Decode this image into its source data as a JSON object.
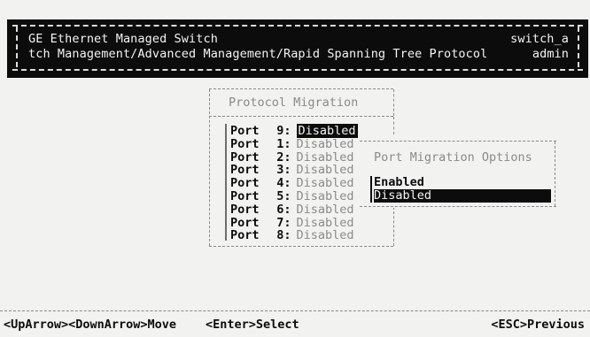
{
  "header": {
    "title": "GE Ethernet Managed Switch",
    "path": "tch Management/Advanced Management/Rapid Spanning Tree Protocol",
    "hostname": "switch_a",
    "user": "admin"
  },
  "menu": {
    "title": "Protocol Migration",
    "port_prefix": "Port",
    "rows": [
      {
        "num": "9:",
        "value": "Disabled",
        "selected": true
      },
      {
        "num": "1:",
        "value": "Disabled",
        "selected": false
      },
      {
        "num": "2:",
        "value": "Disabled",
        "selected": false
      },
      {
        "num": "3:",
        "value": "Disabled",
        "selected": false
      },
      {
        "num": "4:",
        "value": "Disabled",
        "selected": false
      },
      {
        "num": "5:",
        "value": "Disabled",
        "selected": false
      },
      {
        "num": "6:",
        "value": "Disabled",
        "selected": false
      },
      {
        "num": "7:",
        "value": "Disabled",
        "selected": false
      },
      {
        "num": "8:",
        "value": "Disabled",
        "selected": false
      }
    ]
  },
  "popup": {
    "title": "Port Migration Options",
    "options": [
      "Enabled",
      "Disabled"
    ],
    "selected": "Disabled"
  },
  "footer": {
    "move_hint": "<UpArrow><DownArrow>Move",
    "select_hint": "<Enter>Select",
    "previous_hint": "<ESC>Previous"
  }
}
